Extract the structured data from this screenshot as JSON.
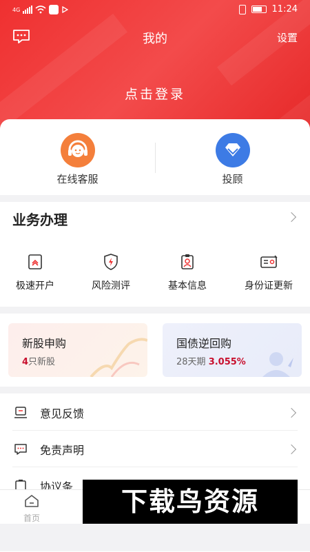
{
  "status_bar": {
    "network": "4G",
    "time": "11:24"
  },
  "header": {
    "title": "我的",
    "settings_label": "设置",
    "login_label": "点击登录",
    "bg_color": "#ef3030"
  },
  "quick_services": [
    {
      "label": "在线客服",
      "icon": "headset-icon",
      "color": "#f47f3b"
    },
    {
      "label": "投顾",
      "icon": "diamond-icon",
      "color": "#3d7be5"
    }
  ],
  "business": {
    "title": "业务办理",
    "items": [
      {
        "label": "极速开户",
        "icon": "fast-account-icon"
      },
      {
        "label": "风险测评",
        "icon": "risk-shield-icon"
      },
      {
        "label": "基本信息",
        "icon": "id-badge-icon"
      },
      {
        "label": "身份证更新",
        "icon": "id-card-update-icon"
      }
    ]
  },
  "cards": [
    {
      "title": "新股申购",
      "count": "4",
      "count_suffix": "只新股",
      "bg": "#fdf0ec"
    },
    {
      "title": "国债逆回购",
      "period": "28天期",
      "rate": "3.055%",
      "bg": "#eef0fb"
    }
  ],
  "menu": [
    {
      "label": "意见反馈",
      "icon": "feedback-icon"
    },
    {
      "label": "免责声明",
      "icon": "chat-bubble-icon"
    },
    {
      "label": "协议条",
      "icon": "clipboard-icon"
    }
  ],
  "tabbar": {
    "home_label": "首页"
  },
  "watermark": "下载鸟资源"
}
